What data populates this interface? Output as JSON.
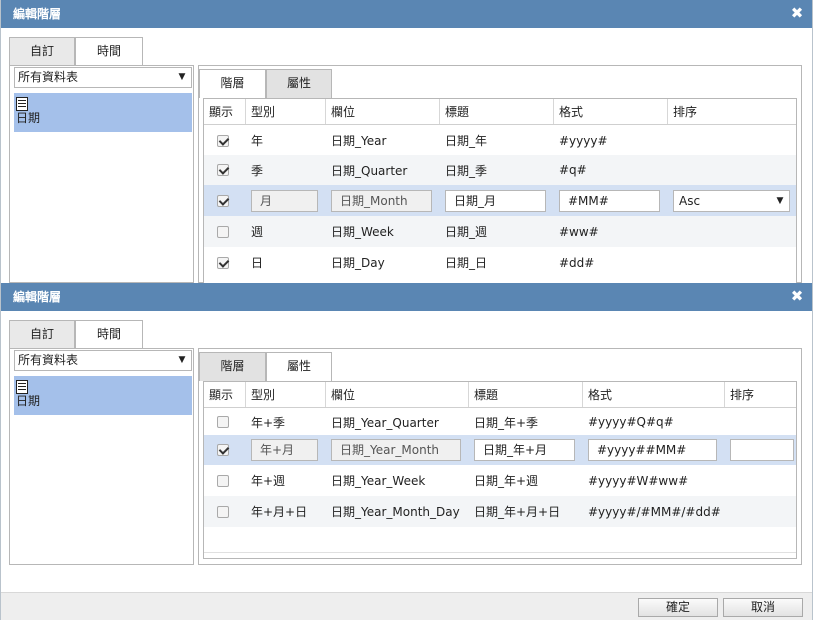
{
  "dialog1": {
    "title": "編輯階層",
    "close_glyph": "✖",
    "outer_tabs": [
      "自訂",
      "時間"
    ],
    "outer_active": 1,
    "select_value": "所有資料表",
    "table_item": "日期",
    "inner_tabs": [
      "階層",
      "屬性"
    ],
    "inner_active": 1,
    "columns": [
      "顯示",
      "型別",
      "欄位",
      "標題",
      "格式",
      "排序"
    ],
    "rows": [
      {
        "checked": true,
        "type": "年",
        "field": "日期_Year",
        "title": "日期_年",
        "format": "#yyyy#",
        "sort": ""
      },
      {
        "checked": true,
        "type": "季",
        "field": "日期_Quarter",
        "title": "日期_季",
        "format": "#q#",
        "sort": ""
      },
      {
        "checked": true,
        "type": "月",
        "field": "日期_Month",
        "title": "日期_月",
        "format": "#MM#",
        "sort": "Asc",
        "editing": true
      },
      {
        "checked": false,
        "type": "週",
        "field": "日期_Week",
        "title": "日期_週",
        "format": "#ww#",
        "sort": ""
      },
      {
        "checked": true,
        "type": "日",
        "field": "日期_Day",
        "title": "日期_日",
        "format": "#dd#",
        "sort": ""
      }
    ]
  },
  "dialog2": {
    "title": "編輯階層",
    "close_glyph": "✖",
    "outer_tabs": [
      "自訂",
      "時間"
    ],
    "outer_active": 1,
    "select_value": "所有資料表",
    "table_item": "日期",
    "inner_tabs": [
      "階層",
      "屬性"
    ],
    "inner_active": 1,
    "columns": [
      "顯示",
      "型別",
      "欄位",
      "標題",
      "格式",
      "排序"
    ],
    "rows": [
      {
        "checked": false,
        "type": "年+季",
        "field": "日期_Year_Quarter",
        "title": "日期_年+季",
        "format": "#yyyy#Q#q#",
        "sort": ""
      },
      {
        "checked": true,
        "type": "年+月",
        "field": "日期_Year_Month",
        "title": "日期_年+月",
        "format": "#yyyy##MM#",
        "sort": "",
        "editing": true
      },
      {
        "checked": false,
        "type": "年+週",
        "field": "日期_Year_Week",
        "title": "日期_年+週",
        "format": "#yyyy#W#ww#",
        "sort": ""
      },
      {
        "checked": false,
        "type": "年+月+日",
        "field": "日期_Year_Month_Day",
        "title": "日期_年+月+日",
        "format": "#yyyy#/#MM#/#dd#",
        "sort": ""
      }
    ],
    "buttons": {
      "ok": "確定",
      "cancel": "取消"
    }
  },
  "icons": {
    "dropdown": "▼",
    "table": "table-document-icon"
  },
  "colors": {
    "titlebar": "#5a86b3",
    "selected_item": "#a4c0ea",
    "selected_row": "#d3e0f3"
  }
}
